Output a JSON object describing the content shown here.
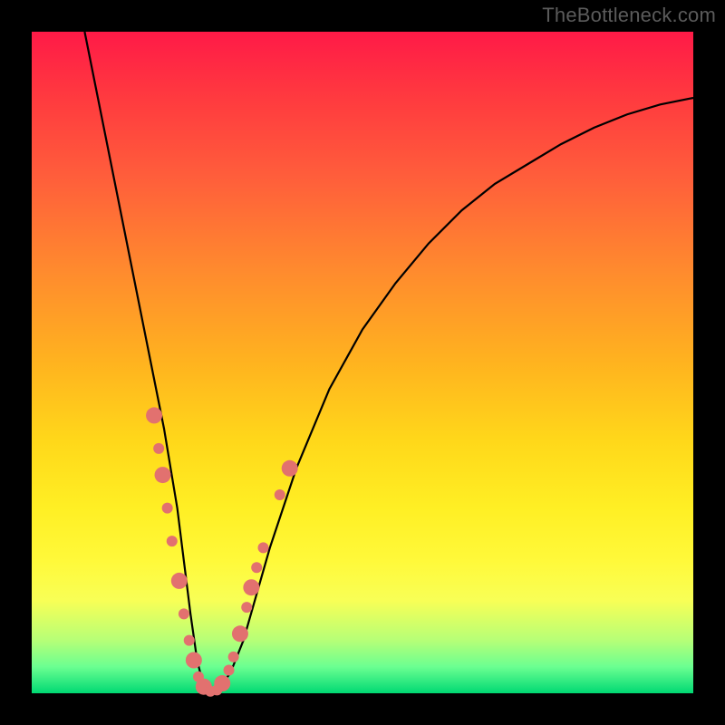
{
  "watermark": "TheBottleneck.com",
  "chart_data": {
    "type": "line",
    "title": "",
    "xlabel": "",
    "ylabel": "",
    "xlim": [
      0,
      100
    ],
    "ylim": [
      0,
      100
    ],
    "grid": false,
    "legend": false,
    "background_gradient": {
      "direction": "vertical",
      "stops": [
        {
          "pos": 0.0,
          "color": "#ff1a47"
        },
        {
          "pos": 0.5,
          "color": "#ffb31f"
        },
        {
          "pos": 0.8,
          "color": "#fff93a"
        },
        {
          "pos": 1.0,
          "color": "#00d973"
        }
      ]
    },
    "series": [
      {
        "name": "bottleneck-curve",
        "color": "#000000",
        "x": [
          8,
          10,
          12,
          14,
          16,
          18,
          20,
          22,
          23,
          24,
          25,
          26,
          27,
          28,
          30,
          32,
          34,
          36,
          40,
          45,
          50,
          55,
          60,
          65,
          70,
          75,
          80,
          85,
          90,
          95,
          100
        ],
        "y": [
          100,
          90,
          80,
          70,
          60,
          50,
          40,
          28,
          20,
          12,
          5,
          1,
          0,
          0.5,
          3,
          8,
          15,
          22,
          34,
          46,
          55,
          62,
          68,
          73,
          77,
          80,
          83,
          85.5,
          87.5,
          89,
          90
        ]
      }
    ],
    "markers": {
      "name": "data-points",
      "color": "#e2716f",
      "radius_small": 6,
      "radius_large": 9,
      "points": [
        {
          "x": 18.5,
          "y": 42,
          "r": "large"
        },
        {
          "x": 19.2,
          "y": 37,
          "r": "small"
        },
        {
          "x": 19.8,
          "y": 33,
          "r": "large"
        },
        {
          "x": 20.5,
          "y": 28,
          "r": "small"
        },
        {
          "x": 21.2,
          "y": 23,
          "r": "small"
        },
        {
          "x": 22.3,
          "y": 17,
          "r": "large"
        },
        {
          "x": 23.0,
          "y": 12,
          "r": "small"
        },
        {
          "x": 23.8,
          "y": 8,
          "r": "small"
        },
        {
          "x": 24.5,
          "y": 5,
          "r": "large"
        },
        {
          "x": 25.2,
          "y": 2.5,
          "r": "small"
        },
        {
          "x": 26.0,
          "y": 1,
          "r": "large"
        },
        {
          "x": 27.0,
          "y": 0.3,
          "r": "small"
        },
        {
          "x": 28.0,
          "y": 0.5,
          "r": "small"
        },
        {
          "x": 28.8,
          "y": 1.5,
          "r": "large"
        },
        {
          "x": 29.8,
          "y": 3.5,
          "r": "small"
        },
        {
          "x": 30.5,
          "y": 5.5,
          "r": "small"
        },
        {
          "x": 31.5,
          "y": 9,
          "r": "large"
        },
        {
          "x": 32.5,
          "y": 13,
          "r": "small"
        },
        {
          "x": 33.2,
          "y": 16,
          "r": "large"
        },
        {
          "x": 34.0,
          "y": 19,
          "r": "small"
        },
        {
          "x": 35.0,
          "y": 22,
          "r": "small"
        },
        {
          "x": 37.5,
          "y": 30,
          "r": "small"
        },
        {
          "x": 39.0,
          "y": 34,
          "r": "large"
        }
      ]
    }
  }
}
